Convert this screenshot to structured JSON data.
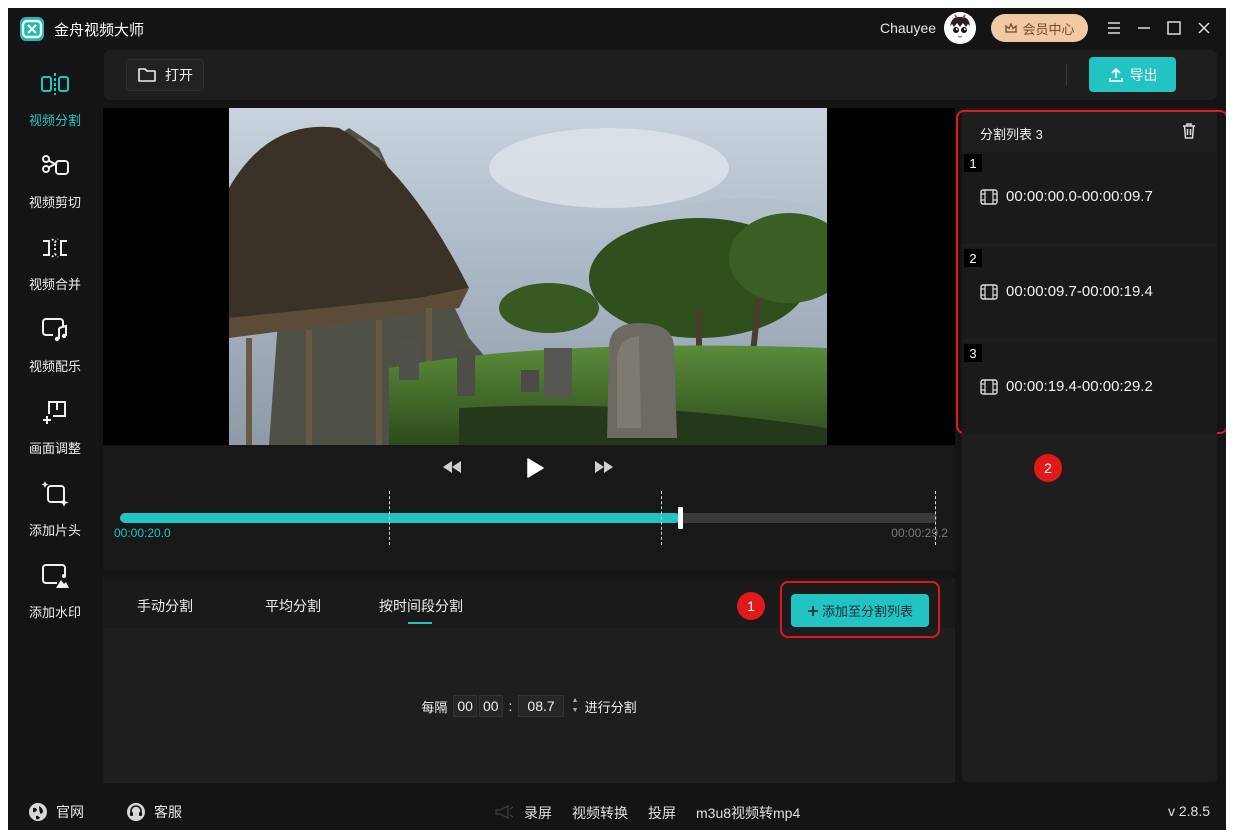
{
  "app": {
    "title": "金舟视频大师",
    "username": "Chauyee",
    "vip_label": "会员中心",
    "accent": "#21c3c3",
    "highlight": "#e01a1a"
  },
  "sidebar": {
    "items": [
      {
        "label": "视频分割",
        "icon": "split-icon",
        "active": true
      },
      {
        "label": "视频剪切",
        "icon": "scissors-icon",
        "active": false
      },
      {
        "label": "视频合并",
        "icon": "merge-icon",
        "active": false
      },
      {
        "label": "视频配乐",
        "icon": "music-note-icon",
        "active": false
      },
      {
        "label": "画面调整",
        "icon": "crop-adjust-icon",
        "active": false
      },
      {
        "label": "添加片头",
        "icon": "sparkle-frame-icon",
        "active": false
      },
      {
        "label": "添加水印",
        "icon": "image-watermark-icon",
        "active": false
      }
    ]
  },
  "toolbar": {
    "open_label": "打开",
    "export_label": "导出"
  },
  "player": {
    "current_time": "00:00:20.0",
    "total_time": "00:00:29.2",
    "progress_fraction": 0.685,
    "split_marks_seconds": [
      9.7,
      19.4,
      29.2
    ],
    "duration_seconds": 29.2
  },
  "tabs": {
    "items": [
      "手动分割",
      "平均分割",
      "按时间段分割"
    ],
    "active_index": 2
  },
  "annotations": {
    "marker_1": "1",
    "marker_2": "2"
  },
  "add_button_label": "添加至分割列表",
  "interval": {
    "prefix": "每隔",
    "hh": "00",
    "mm": "00",
    "ss": "08.7",
    "suffix": "进行分割"
  },
  "split_list": {
    "title": "分割列表 3",
    "segments": [
      {
        "index": "1",
        "range": "00:00:00.0-00:00:09.7"
      },
      {
        "index": "2",
        "range": "00:00:09.7-00:00:19.4"
      },
      {
        "index": "3",
        "range": "00:00:19.4-00:00:29.2"
      }
    ]
  },
  "statusbar": {
    "website": "官网",
    "support": "客服",
    "tools": [
      "录屏",
      "视频转换",
      "投屏",
      "m3u8视频转mp4"
    ],
    "version": "v 2.8.5"
  }
}
